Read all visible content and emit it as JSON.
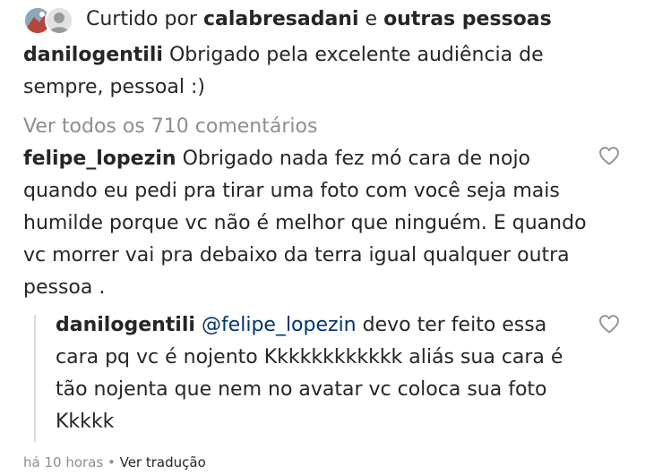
{
  "likes": {
    "prefix": "Curtido por",
    "user": "calabresadani",
    "conjunction": "e",
    "others": "outras pessoas",
    "avatar_icons": [
      "profile-avatar-icon",
      "profile-avatar-icon"
    ]
  },
  "caption": {
    "username": "danilogentili",
    "text": "Obrigado pela excelente audiência de sempre, pessoal :)"
  },
  "view_all_comments": "Ver todos os 710 comentários",
  "comment": {
    "username": "felipe_lopezin",
    "text": "Obrigado nada fez mó cara de nojo quando eu pedi pra tirar uma foto com você seja mais humilde porque vc não é melhor que ninguém. E quando vc morrer vai pra debaixo da terra igual qualquer outra pessoa .",
    "like_icon": "heart-outline-icon"
  },
  "reply": {
    "username": "danilogentili",
    "mention": "@felipe_lopezin",
    "text": "devo ter feito essa cara pq vc é nojento Kkkkkkkkkkkk aliás sua cara é tão nojenta que nem no avatar vc coloca sua foto Kkkkk",
    "like_icon": "heart-outline-icon"
  },
  "meta": {
    "time": "há 10 horas",
    "separator": "•",
    "translate": "Ver tradução"
  },
  "colors": {
    "text": "#262626",
    "secondary": "#8e8e8e",
    "mention": "#003569",
    "thread_line": "#dbdbdb"
  }
}
